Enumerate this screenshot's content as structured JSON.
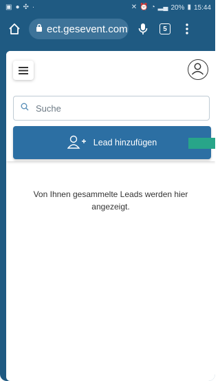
{
  "statusbar": {
    "left_icons": [
      "gallery-icon",
      "chat-icon",
      "fan-icon",
      "dot"
    ],
    "signal_text": "20%",
    "time": "15:44"
  },
  "browser": {
    "url": "ect.gesevent.com",
    "tab_count": "5"
  },
  "page": {
    "search_placeholder": "Suche",
    "add_lead_label": "Lead hinzufügen",
    "empty_message": "Von Ihnen gesammelte Leads werden hier angezeigt."
  },
  "colors": {
    "theme": "#1f5a82",
    "primary_button": "#2c6fa3",
    "accent_green": "#28a589"
  }
}
